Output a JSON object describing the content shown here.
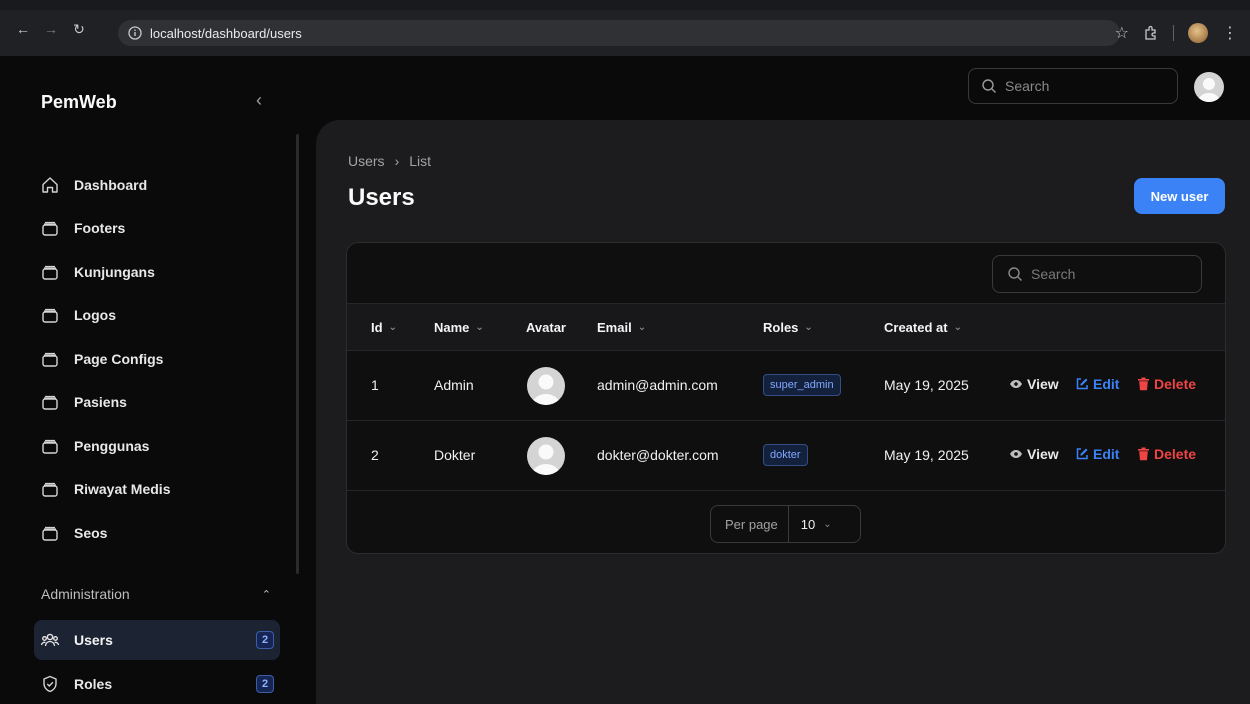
{
  "browser": {
    "url": "localhost/dashboard/users"
  },
  "sidebar": {
    "brand": "PemWeb",
    "items": [
      {
        "label": "Dashboard",
        "icon": "home-icon"
      },
      {
        "label": "Footers",
        "icon": "rectangle-stack-icon"
      },
      {
        "label": "Kunjungans",
        "icon": "rectangle-stack-icon"
      },
      {
        "label": "Logos",
        "icon": "rectangle-stack-icon"
      },
      {
        "label": "Page Configs",
        "icon": "rectangle-stack-icon"
      },
      {
        "label": "Pasiens",
        "icon": "rectangle-stack-icon"
      },
      {
        "label": "Penggunas",
        "icon": "rectangle-stack-icon"
      },
      {
        "label": "Riwayat Medis",
        "icon": "rectangle-stack-icon"
      },
      {
        "label": "Seos",
        "icon": "rectangle-stack-icon"
      }
    ],
    "group": {
      "label": "Administration",
      "items": [
        {
          "label": "Users",
          "badge": "2",
          "icon": "users-icon",
          "active": true
        },
        {
          "label": "Roles",
          "badge": "2",
          "icon": "shield-check-icon",
          "active": false
        }
      ]
    }
  },
  "topbar": {
    "search_placeholder": "Search"
  },
  "page": {
    "breadcrumb": [
      "Users",
      "List"
    ],
    "title": "Users",
    "new_user_label": "New user"
  },
  "table": {
    "search_placeholder": "Search",
    "columns": [
      "Id",
      "Name",
      "Avatar",
      "Email",
      "Roles",
      "Created at"
    ],
    "rows": [
      {
        "id": "1",
        "name": "Admin",
        "email": "admin@admin.com",
        "role": "super_admin",
        "created_at": "May 19, 2025"
      },
      {
        "id": "2",
        "name": "Dokter",
        "email": "dokter@dokter.com",
        "role": "dokter",
        "created_at": "May 19, 2025"
      }
    ],
    "actions": {
      "view": "View",
      "edit": "Edit",
      "delete": "Delete"
    },
    "pager": {
      "label": "Per page",
      "value": "10"
    }
  },
  "colors": {
    "accent": "#3b82f6",
    "danger": "#ef4444",
    "panel": "#1c1c1e"
  }
}
